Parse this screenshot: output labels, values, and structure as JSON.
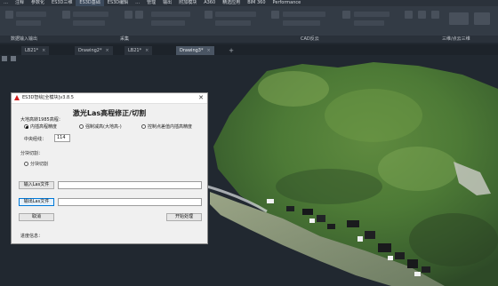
{
  "menu": [
    {
      "label": "…",
      "active": false
    },
    {
      "label": "注释",
      "active": false
    },
    {
      "label": "参数化",
      "active": false
    },
    {
      "label": "ES3D三维",
      "active": false
    },
    {
      "label": "ES3D基础",
      "active": true
    },
    {
      "label": "ES3D编辑",
      "active": false
    },
    {
      "label": "…",
      "active": false
    },
    {
      "label": "管理",
      "active": false
    },
    {
      "label": "输出",
      "active": false
    },
    {
      "label": "附加模块",
      "active": false
    },
    {
      "label": "A360",
      "active": false
    },
    {
      "label": "精选应用",
      "active": false
    },
    {
      "label": "BIM 360",
      "active": false
    },
    {
      "label": "Performance",
      "active": false
    }
  ],
  "panels": {
    "left": "数据输入输出",
    "mid": "采集",
    "cad": "CAD反云",
    "right": "三维/点云三维"
  },
  "doc_tabs": [
    {
      "label": "LB21*",
      "active": false
    },
    {
      "label": "Drawing2*",
      "active": false
    },
    {
      "label": "LB21*",
      "active": false
    },
    {
      "label": "Drawing3*",
      "active": true
    }
  ],
  "dialog": {
    "title": "ES3D智绘[全模块]v3.8.5",
    "close": "✕",
    "heading": "激光Las高程修正/切割",
    "elev_group": "大地高转1985高程：",
    "radios": [
      {
        "label": "内插高程精度",
        "checked": true
      },
      {
        "label": "强制减高(大地高-)",
        "checked": false
      },
      {
        "label": "控制点差值内插高精度",
        "checked": false
      }
    ],
    "meridian_label": "中央经线：",
    "meridian_value": "114",
    "block_group": "分块切割：",
    "block_radio": "分块切割",
    "input_btn": "输入Las文件",
    "input_value": "",
    "output_btn": "输出Las文件",
    "output_value": "",
    "cancel_btn": "取消",
    "start_btn": "开始处理",
    "status": "进度信息："
  }
}
